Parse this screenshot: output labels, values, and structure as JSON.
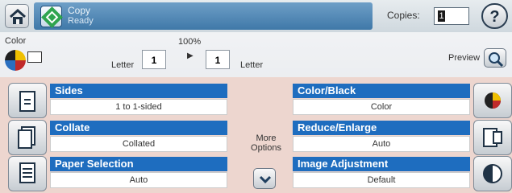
{
  "top": {
    "job_title": "Copy",
    "job_status": "Ready",
    "copies_label": "Copies:",
    "copies_value": "1"
  },
  "settings_row": {
    "color_label": "Color",
    "paper_in": "Letter",
    "paper_out": "Letter",
    "zoom_label": "100%",
    "left_count": "1",
    "right_count": "1",
    "preview_label": "Preview"
  },
  "options": {
    "sides": {
      "title": "Sides",
      "value": "1 to 1-sided"
    },
    "collate": {
      "title": "Collate",
      "value": "Collated"
    },
    "paper_selection": {
      "title": "Paper Selection",
      "value": "Auto"
    },
    "color_black": {
      "title": "Color/Black",
      "value": "Color"
    },
    "reduce_enlarge": {
      "title": "Reduce/Enlarge",
      "value": "Auto"
    },
    "image_adjustment": {
      "title": "Image Adjustment",
      "value": "Default"
    },
    "more_options_line1": "More",
    "more_options_line2": "Options"
  },
  "colors": {
    "title_bar": "#1e6dbf",
    "start_bar": "#3f78a8",
    "panel_bg": "#edd6cf"
  }
}
